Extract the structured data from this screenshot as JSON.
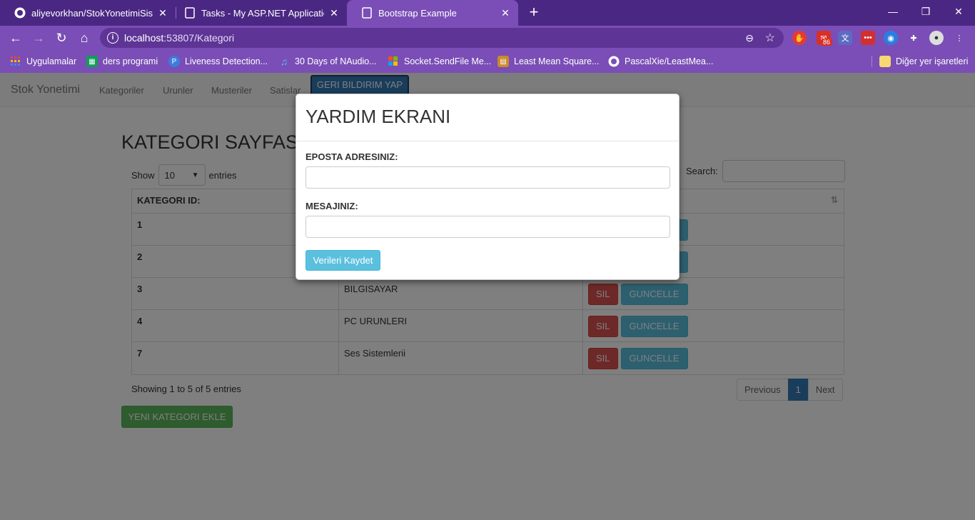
{
  "browser": {
    "tabs": [
      {
        "title": "aliyevorkhan/StokYonetimiSistem",
        "icon": "github-icon"
      },
      {
        "title": "Tasks - My ASP.NET Application",
        "icon": "page-icon"
      },
      {
        "title": "Bootstrap Example",
        "icon": "page-icon",
        "active": true
      }
    ],
    "url_host": "localhost",
    "url_rest": ":53807/Kategori",
    "bookmarks": [
      {
        "label": "Uygulamalar",
        "icon": "apps-grid-icon",
        "color": "#e8453c"
      },
      {
        "label": "ders programi",
        "icon": "sheets-icon",
        "color": "#0f9d58"
      },
      {
        "label": "Liveness Detection...",
        "icon": "pyimagesearch-icon",
        "color": "#3b7ddd"
      },
      {
        "label": "30 Days of NAudio...",
        "icon": "music-note-icon",
        "color": "#4fc3f7"
      },
      {
        "label": "Socket.SendFile Me...",
        "icon": "microsoft-icon",
        "color": "#f25022"
      },
      {
        "label": "Least Mean Square...",
        "icon": "book-icon",
        "color": "#c98a2b"
      },
      {
        "label": "PascalXie/LeastMea...",
        "icon": "github-icon",
        "color": "#ffffff"
      },
      {
        "label": "Diğer yer işaretleri",
        "icon": "folder-icon",
        "color": "#f7d774"
      }
    ],
    "extension_badge": "86"
  },
  "navbar": {
    "brand": "Stok Yonetimi",
    "links": [
      "Kategoriler",
      "Urunler",
      "Musteriler",
      "Satislar"
    ],
    "feedback_button": "GERI BILDIRIM YAP"
  },
  "page": {
    "title": "KATEGORI SAYFASI",
    "show_label": "Show",
    "entries_select": "10",
    "entries_label": "entries",
    "search_label": "Search:",
    "columns": [
      "KATEGORI ID:",
      "",
      ""
    ],
    "rows": [
      {
        "id": "1",
        "name": ""
      },
      {
        "id": "2",
        "name": ""
      },
      {
        "id": "3",
        "name": "BILGISAYAR"
      },
      {
        "id": "4",
        "name": "PC URUNLERI"
      },
      {
        "id": "7",
        "name": "Ses Sistemlerii"
      }
    ],
    "delete_label": "SIL",
    "update_label": "GUNCELLE",
    "info": "Showing 1 to 5 of 5 entries",
    "pager": {
      "previous": "Previous",
      "current": "1",
      "next": "Next"
    },
    "add_button": "YENI KATEGORI EKLE"
  },
  "modal": {
    "title": "YARDIM EKRANI",
    "email_label": "EPOSTA ADRESINIZ:",
    "email_value": "",
    "message_label": "MESAJINIZ:",
    "message_value": "",
    "save_button": "Verileri Kaydet"
  }
}
